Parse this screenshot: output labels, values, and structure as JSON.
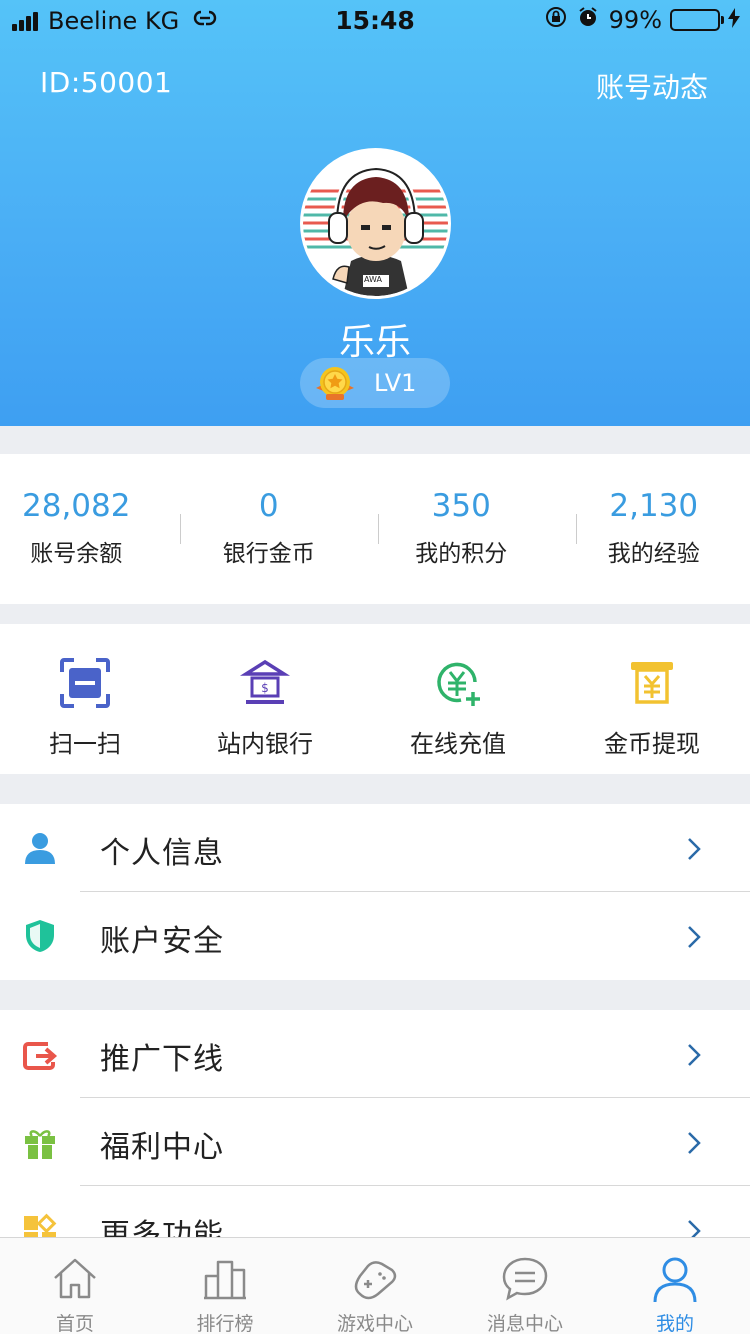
{
  "status_bar": {
    "carrier": "Beeline KG",
    "time": "15:48",
    "battery": "99%",
    "battery_level": 0.99
  },
  "header": {
    "user_id": "ID:50001",
    "activity_link": "账号动态",
    "nickname": "乐乐",
    "level": "LV1",
    "avatar_badge_text": "AWA"
  },
  "stats": [
    {
      "value": "28,082",
      "label": "账号余额"
    },
    {
      "value": "0",
      "label": "银行金币"
    },
    {
      "value": "350",
      "label": "我的积分"
    },
    {
      "value": "2,130",
      "label": "我的经验"
    }
  ],
  "quick_actions": [
    {
      "label": "扫一扫",
      "icon": "scan-icon",
      "color": "#4a63c9"
    },
    {
      "label": "站内银行",
      "icon": "bank-icon",
      "color": "#5a3fb5"
    },
    {
      "label": "在线充值",
      "icon": "recharge-icon",
      "color": "#2fb36a"
    },
    {
      "label": "金币提现",
      "icon": "withdraw-icon",
      "color": "#f2c230"
    }
  ],
  "menu_group_1": [
    {
      "label": "个人信息",
      "icon": "person-icon",
      "color": "#3a9ce0"
    },
    {
      "label": "账户安全",
      "icon": "shield-icon",
      "color": "#1fc29a"
    }
  ],
  "menu_group_2": [
    {
      "label": "推广下线",
      "icon": "share-icon",
      "color": "#e9564b"
    },
    {
      "label": "福利中心",
      "icon": "gift-icon",
      "color": "#7ac142"
    },
    {
      "label": "更多功能",
      "icon": "more-icon",
      "color": "#f5c33b"
    }
  ],
  "tabbar": [
    {
      "label": "首页",
      "icon": "home-icon",
      "active": false
    },
    {
      "label": "排行榜",
      "icon": "ranking-icon",
      "active": false
    },
    {
      "label": "游戏中心",
      "icon": "gamepad-icon",
      "active": false
    },
    {
      "label": "消息中心",
      "icon": "message-icon",
      "active": false
    },
    {
      "label": "我的",
      "icon": "profile-icon",
      "active": true
    }
  ],
  "colors": {
    "header_gradient_top": "#55c3f8",
    "header_gradient_bottom": "#3e9ff2",
    "stat_value": "#3a9ce0",
    "tab_active": "#2f8de4"
  }
}
